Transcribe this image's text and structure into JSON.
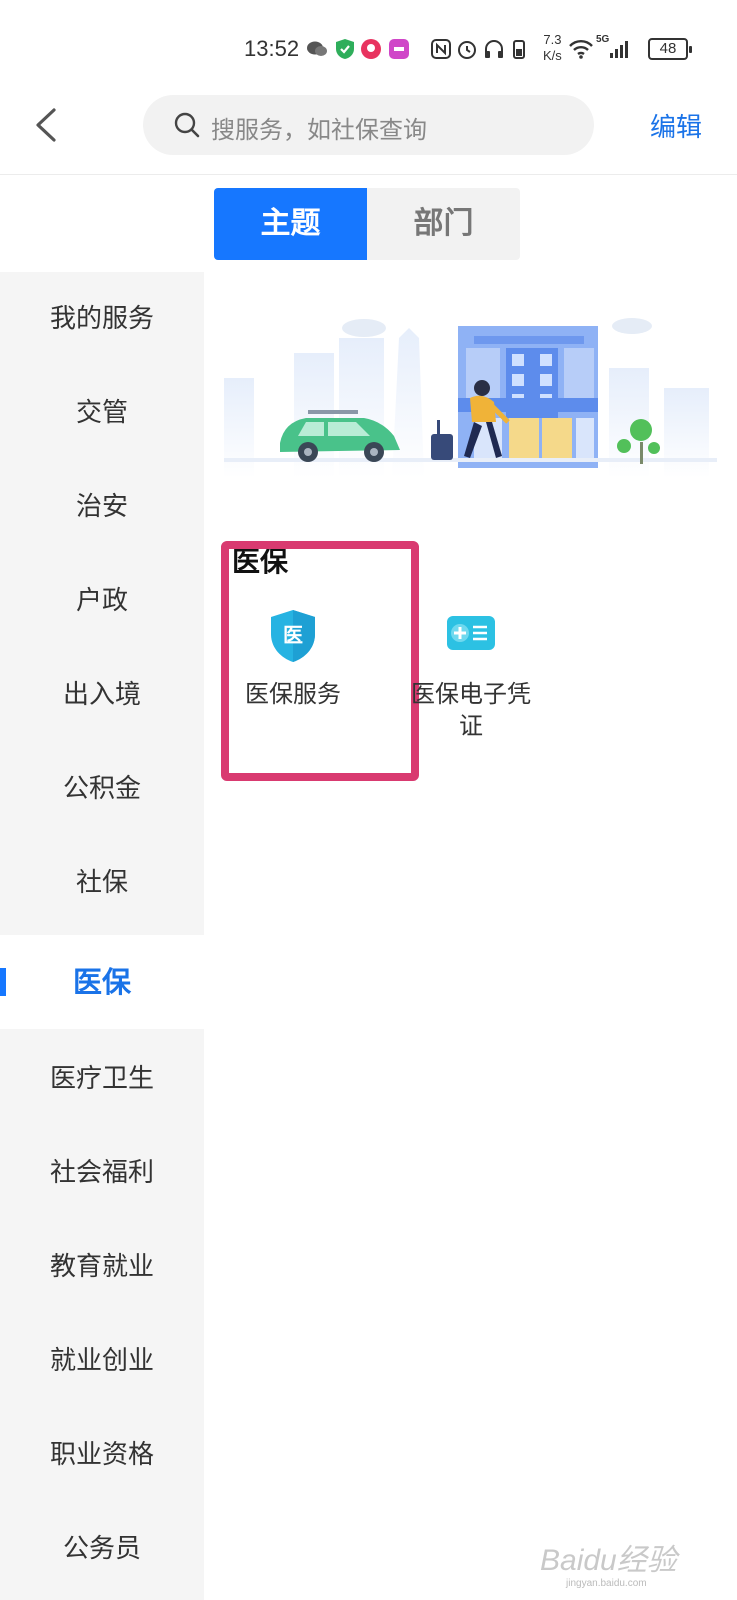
{
  "status_bar": {
    "time": "13:52",
    "speed_value": "7.3",
    "speed_unit": "K/s",
    "network": "5G",
    "battery": "48"
  },
  "header": {
    "search_placeholder": "搜服务，如社保查询",
    "edit_label": "编辑"
  },
  "tabs": [
    {
      "label": "主题",
      "active": true
    },
    {
      "label": "部门",
      "active": false
    }
  ],
  "sidebar": {
    "items": [
      {
        "label": "我的服务"
      },
      {
        "label": "交管"
      },
      {
        "label": "治安"
      },
      {
        "label": "户政"
      },
      {
        "label": "出入境"
      },
      {
        "label": "公积金"
      },
      {
        "label": "社保"
      },
      {
        "label": "医保",
        "active": true
      },
      {
        "label": "医疗卫生"
      },
      {
        "label": "社会福利"
      },
      {
        "label": "教育就业"
      },
      {
        "label": "就业创业"
      },
      {
        "label": "职业资格"
      },
      {
        "label": "公务员"
      }
    ]
  },
  "section": {
    "title": "医保",
    "services": [
      {
        "label": "医保服务",
        "icon": "medical-shield-icon",
        "icon_text": "医"
      },
      {
        "label": "医保电子凭证",
        "icon": "medical-card-icon"
      }
    ]
  },
  "colors": {
    "accent": "#1677ff",
    "highlight": "#d93a70",
    "sidebar_bg": "#f5f5f5"
  },
  "watermark": {
    "text": "Baidu经验",
    "sub": "jingyan.baidu.com"
  }
}
